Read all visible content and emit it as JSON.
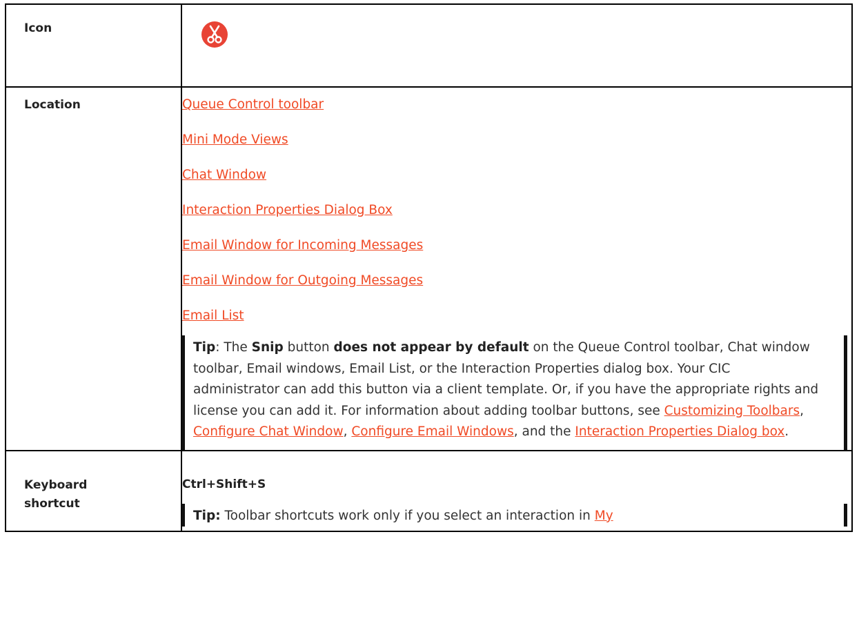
{
  "rows": {
    "icon": {
      "label": "Icon",
      "icon_name": "scissors-icon",
      "icon_bg": "#e84335"
    },
    "location": {
      "label": "Location",
      "links": [
        "Queue Control toolbar",
        "Mini Mode Views",
        "Chat Window",
        "Interaction Properties Dialog Box",
        "Email Window for Incoming Messages",
        "Email Window for Outgoing Messages",
        "Email List"
      ],
      "tip": {
        "t1": "Tip",
        "t2": ": The ",
        "t3": "Snip",
        "t4": " button ",
        "t5": "does not appear by default",
        "t6": " on the Queue Control toolbar, Chat window toolbar, Email windows, Email List, or the Interaction Properties dialog box. Your CIC administrator can add this button via a client template. Or, if you have the appropriate rights and license you can add it. For information about adding toolbar buttons, see ",
        "link1": "Customizing Toolbars",
        "t7": ", ",
        "link2": "Configure Chat Window",
        "t8": ", ",
        "link3": "Configure Email Windows",
        "t9": ", and the ",
        "link4": "Interaction Properties Dialog box",
        "t10": "."
      }
    },
    "keyboard": {
      "label_line1": "Keyboard",
      "label_line2": "shortcut",
      "value": "Ctrl+Shift+S",
      "tip": {
        "t1": "Tip:",
        "t2": " Toolbar shortcuts work only if you select an interaction in ",
        "link": "My"
      }
    }
  },
  "colors": {
    "link": "#f04a25",
    "border": "#000000",
    "text": "#333333"
  }
}
